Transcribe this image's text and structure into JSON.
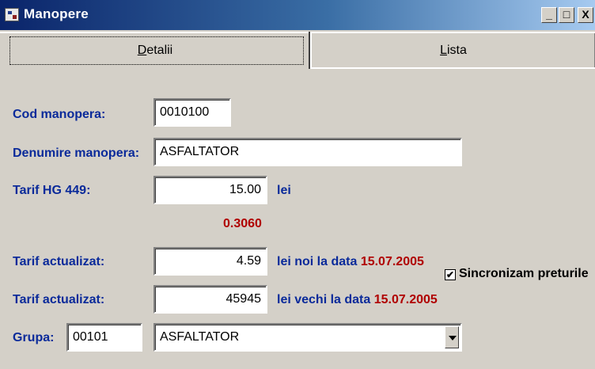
{
  "window": {
    "title": "Manopere",
    "controls": [
      "_",
      "□",
      "X"
    ]
  },
  "tabs": [
    {
      "label_underlined": "D",
      "label_rest": "etalii",
      "active": true
    },
    {
      "label_underlined": "L",
      "label_rest": "ista",
      "active": false
    }
  ],
  "form": {
    "cod_label": "Cod manopera:",
    "cod_value": "0010100",
    "denumire_label": "Denumire manopera:",
    "denumire_value": "ASFALTATOR",
    "tarif_hg_label": "Tarif HG 449:",
    "tarif_hg_value": "15.00",
    "tarif_hg_unit": "lei",
    "coef_value": "0.3060",
    "tarif_act1_label": "Tarif actualizat:",
    "tarif_act1_value": "4.59",
    "tarif_act1_text": "lei noi la data",
    "tarif_act1_date": "15.07.2005",
    "tarif_act2_label": "Tarif actualizat:",
    "tarif_act2_value": "45945",
    "tarif_act2_text": "lei vechi la data",
    "tarif_act2_date": "15.07.2005",
    "sync_label": "Sincronizam preturile",
    "sync_checked": "✔",
    "grupa_label": "Grupa:",
    "grupa_code": "00101",
    "grupa_value": "ASFALTATOR"
  }
}
